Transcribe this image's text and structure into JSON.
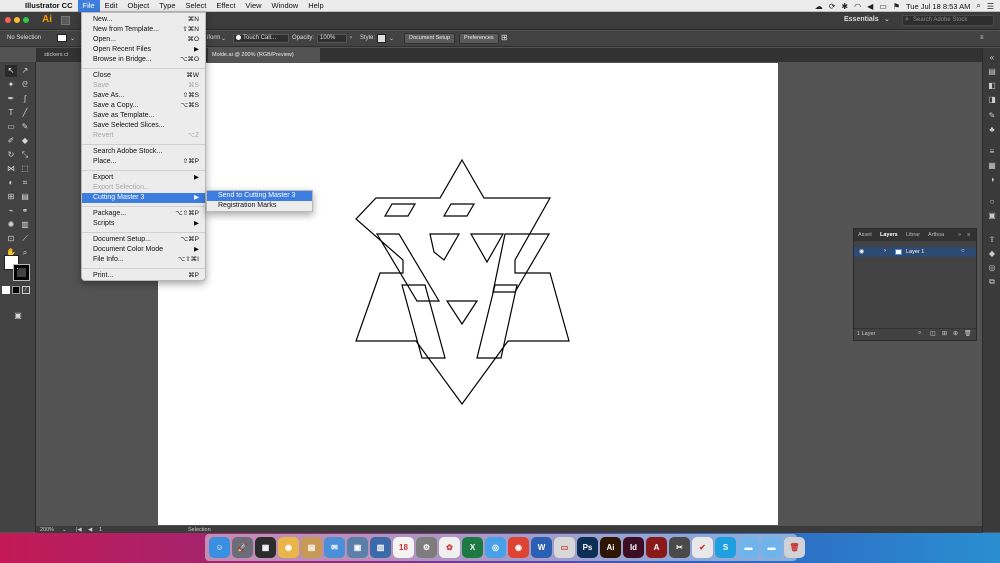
{
  "mac_menubar": {
    "app_name": "Illustrator CC",
    "menus": [
      "File",
      "Edit",
      "Object",
      "Type",
      "Select",
      "Effect",
      "View",
      "Window",
      "Help"
    ],
    "active_menu": "File",
    "clock": "Tue Jul 18  8:53 AM"
  },
  "app_bar": {
    "logo": "Ai",
    "workspace": "Essentials",
    "search_placeholder": "Search Adobe Stock"
  },
  "control_bar": {
    "selection": "No Selection",
    "stroke_partial": "iform",
    "brush": "Touch Call...",
    "opacity_label": "Opacity:",
    "opacity_value": "100%",
    "style_label": "Style:",
    "document_setup": "Document Setup",
    "preferences": "Preferences"
  },
  "tabs": {
    "left_tab": "stickers ci",
    "active_tab": "Molde.ai @ 200% (RGB/Preview)"
  },
  "file_menu": {
    "items": [
      {
        "label": "New...",
        "shortcut": "⌘N",
        "disabled": false
      },
      {
        "label": "New from Template...",
        "shortcut": "⇧⌘N",
        "disabled": false
      },
      {
        "label": "Open...",
        "shortcut": "⌘O",
        "disabled": false
      },
      {
        "label": "Open Recent Files",
        "shortcut": "▶",
        "disabled": false
      },
      {
        "label": "Browse in Bridge...",
        "shortcut": "⌥⌘O",
        "disabled": false
      },
      {
        "label": "Close",
        "shortcut": "⌘W",
        "disabled": false
      },
      {
        "label": "Save",
        "shortcut": "⌘S",
        "disabled": true
      },
      {
        "label": "Save As...",
        "shortcut": "⇧⌘S",
        "disabled": false
      },
      {
        "label": "Save a Copy...",
        "shortcut": "⌥⌘S",
        "disabled": false
      },
      {
        "label": "Save as Template...",
        "shortcut": "",
        "disabled": false
      },
      {
        "label": "Save Selected Slices...",
        "shortcut": "",
        "disabled": false
      },
      {
        "label": "Revert",
        "shortcut": "⌥Z",
        "disabled": true
      },
      {
        "label": "Search Adobe Stock...",
        "shortcut": "",
        "disabled": false
      },
      {
        "label": "Place...",
        "shortcut": "⇧⌘P",
        "disabled": false
      },
      {
        "label": "Export",
        "shortcut": "▶",
        "disabled": false
      },
      {
        "label": "Export Selection...",
        "shortcut": "",
        "disabled": true
      },
      {
        "label": "Cutting Master 3",
        "shortcut": "▶",
        "disabled": false
      },
      {
        "label": "Package...",
        "shortcut": "⌥⇧⌘P",
        "disabled": false
      },
      {
        "label": "Scripts",
        "shortcut": "▶",
        "disabled": false
      },
      {
        "label": "Document Setup...",
        "shortcut": "⌥⌘P",
        "disabled": false
      },
      {
        "label": "Document Color Mode",
        "shortcut": "▶",
        "disabled": false
      },
      {
        "label": "File Info...",
        "shortcut": "⌥⇧⌘I",
        "disabled": false
      },
      {
        "label": "Print...",
        "shortcut": "⌘P",
        "disabled": false
      }
    ],
    "highlighted": "Cutting Master 3"
  },
  "submenu": {
    "items": [
      "Send to Cutting Master 3",
      "Registration Marks"
    ],
    "highlighted": "Send to Cutting Master 3"
  },
  "layers_panel": {
    "tabs": [
      "Asset",
      "Layers",
      "Librar",
      "Artboa"
    ],
    "active_tab": "Layers",
    "layer_name": "Layer 1",
    "footer": "1 Layer"
  },
  "status_bar": {
    "zoom": "200%",
    "artboard_number": "1",
    "tool": "Selection"
  },
  "dock": {
    "apps": [
      {
        "name": "finder",
        "label": "☺",
        "color": "#3b8fe0"
      },
      {
        "name": "launchpad",
        "label": "🚀",
        "color": "#6d6d7a"
      },
      {
        "name": "app-a",
        "label": "▦",
        "color": "#2c2c2c"
      },
      {
        "name": "app-b",
        "label": "◉",
        "color": "#e8b64a"
      },
      {
        "name": "contacts",
        "label": "▤",
        "color": "#c79a55"
      },
      {
        "name": "mail",
        "label": "✉",
        "color": "#4a8fd8"
      },
      {
        "name": "preview",
        "label": "▣",
        "color": "#5a7fa8"
      },
      {
        "name": "photos-viewer",
        "label": "▥",
        "color": "#3a6aa8"
      },
      {
        "name": "calendar",
        "label": "18",
        "color": "#f4f4f4"
      },
      {
        "name": "system-preferences",
        "label": "⚙",
        "color": "#7d7d7d"
      },
      {
        "name": "photos",
        "label": "✿",
        "color": "#f0f0f0"
      },
      {
        "name": "excel",
        "label": "X",
        "color": "#1e7a45"
      },
      {
        "name": "safari",
        "label": "◎",
        "color": "#4aa0e8"
      },
      {
        "name": "chrome",
        "label": "◉",
        "color": "#dd4433"
      },
      {
        "name": "word",
        "label": "W",
        "color": "#2b5fb3"
      },
      {
        "name": "notes",
        "label": "▭",
        "color": "#d8d8d8"
      },
      {
        "name": "photoshop",
        "label": "Ps",
        "color": "#0d2e55"
      },
      {
        "name": "illustrator",
        "label": "Ai",
        "color": "#2e1500"
      },
      {
        "name": "indesign",
        "label": "Id",
        "color": "#3d0d24"
      },
      {
        "name": "acrobat",
        "label": "A",
        "color": "#8a1a1a"
      },
      {
        "name": "cutting-master",
        "label": "✂",
        "color": "#4a4a4a"
      },
      {
        "name": "app-c",
        "label": "✔",
        "color": "#e8e8e8"
      },
      {
        "name": "skype",
        "label": "S",
        "color": "#1ea0e0"
      },
      {
        "name": "folder-1",
        "label": "▬",
        "color": "#6fb4ea"
      },
      {
        "name": "folder-2",
        "label": "▬",
        "color": "#6fb4ea"
      },
      {
        "name": "trash",
        "label": "🗑",
        "color": "#cfd3d8"
      }
    ]
  },
  "colors": {
    "menu_highlight": "#3d7de0",
    "illustrator_orange": "#ff9a00",
    "panel_bg": "#424242",
    "pasteboard": "#535353"
  }
}
